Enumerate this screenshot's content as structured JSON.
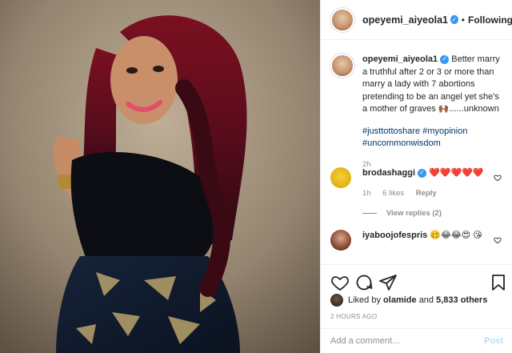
{
  "post": {
    "username": "opeyemi_aiyeola1",
    "follow_status": "Following",
    "separator": "•",
    "verified_mark": "✓"
  },
  "caption": {
    "username": "opeyemi_aiyeola1",
    "text": "Better marry a truthful after 2 or 3 or more than marry a lady with 7 abortions pretending to be an angel yet she's a mother of graves 🙌🏾......unknown",
    "hashtags": "#justtottoshare #myopinion #uncommonwisdom",
    "time": "2h"
  },
  "comments": [
    {
      "username": "brodashaggi",
      "text": "❤️❤️❤️❤️❤️",
      "time": "1h",
      "likes": "6 likes",
      "reply_label": "Reply",
      "view_replies": "View replies (2)"
    },
    {
      "username": "iyaboojofespris",
      "text": "🥴😂😂😍 😘"
    }
  ],
  "actions": {
    "icons": [
      "heart-icon",
      "comment-icon",
      "share-icon",
      "bookmark-icon"
    ]
  },
  "likes": {
    "prefix": "Liked by",
    "user": "olamide",
    "connector": "and",
    "others": "5,833 others"
  },
  "post_time": "2 HOURS AGO",
  "add_comment": {
    "placeholder": "Add a comment…",
    "post_label": "Post"
  },
  "colors": {
    "link": "#00376b",
    "verified": "#3897f0",
    "muted": "#8e8e8e",
    "post_disabled": "#b2dffc"
  }
}
